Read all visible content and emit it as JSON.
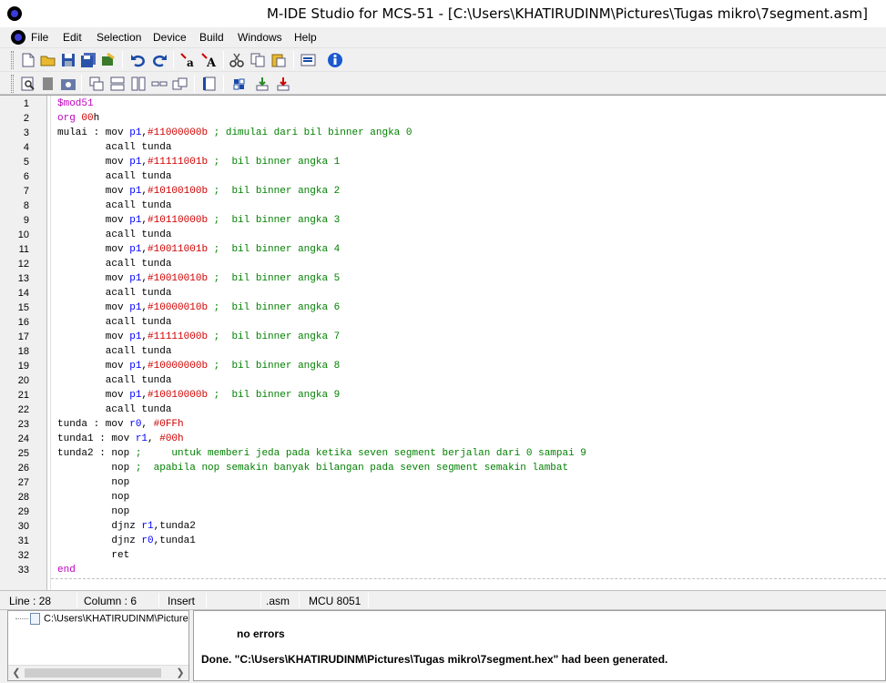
{
  "window": {
    "title": "M-IDE Studio for MCS-51 - [C:\\Users\\KHATIRUDINM\\Pictures\\Tugas mikro\\7segment.asm]"
  },
  "menu": {
    "items": [
      {
        "label": "File"
      },
      {
        "label": "Edit"
      },
      {
        "label": "Selection"
      },
      {
        "label": "Device"
      },
      {
        "label": "Build"
      },
      {
        "label": "Windows"
      },
      {
        "label": "Help"
      }
    ]
  },
  "toolbar": {
    "row1": [
      "new-file-icon",
      "open-folder-icon",
      "save-icon",
      "save-all-icon",
      "close-file-icon",
      "undo-icon",
      "redo-icon",
      "lowercase-icon",
      "uppercase-icon",
      "cut-icon",
      "copy-icon",
      "paste-icon",
      "properties-icon",
      "info-icon"
    ],
    "row2": [
      "find-icon",
      "bookmark-icon",
      "replace-icon",
      "cascade-windows-icon",
      "tile-horizontal-icon",
      "tile-vertical-icon",
      "minimize-all-icon",
      "arrange-icons-icon",
      "page-icon",
      "build-icon",
      "download-icon",
      "run-icon"
    ]
  },
  "editor": {
    "line_numbers": [
      "1",
      "2",
      "3",
      "4",
      "5",
      "6",
      "7",
      "8",
      "9",
      "10",
      "11",
      "12",
      "13",
      "14",
      "15",
      "16",
      "17",
      "18",
      "19",
      "20",
      "21",
      "22",
      "23",
      "24",
      "25",
      "26",
      "27",
      "28",
      "29",
      "30",
      "31",
      "32",
      "33"
    ],
    "code": [
      [
        {
          "t": "$mod51",
          "c": "kw"
        }
      ],
      [
        {
          "t": "org ",
          "c": "kw"
        },
        {
          "t": "00",
          "c": "num"
        },
        {
          "t": "h",
          "c": ""
        }
      ],
      [
        {
          "t": "mulai : mov ",
          "c": ""
        },
        {
          "t": "p1",
          "c": "reg"
        },
        {
          "t": ",",
          "c": ""
        },
        {
          "t": "#11000000b",
          "c": "num"
        },
        {
          "t": " ; dimulai dari bil binner angka 0",
          "c": "cmt"
        }
      ],
      [
        {
          "t": "        acall tunda",
          "c": ""
        }
      ],
      [
        {
          "t": "        mov ",
          "c": ""
        },
        {
          "t": "p1",
          "c": "reg"
        },
        {
          "t": ",",
          "c": ""
        },
        {
          "t": "#11111001b",
          "c": "num"
        },
        {
          "t": " ;  bil binner angka 1",
          "c": "cmt"
        }
      ],
      [
        {
          "t": "        acall tunda",
          "c": ""
        }
      ],
      [
        {
          "t": "        mov ",
          "c": ""
        },
        {
          "t": "p1",
          "c": "reg"
        },
        {
          "t": ",",
          "c": ""
        },
        {
          "t": "#10100100b",
          "c": "num"
        },
        {
          "t": " ;  bil binner angka 2",
          "c": "cmt"
        }
      ],
      [
        {
          "t": "        acall tunda",
          "c": ""
        }
      ],
      [
        {
          "t": "        mov ",
          "c": ""
        },
        {
          "t": "p1",
          "c": "reg"
        },
        {
          "t": ",",
          "c": ""
        },
        {
          "t": "#10110000b",
          "c": "num"
        },
        {
          "t": " ;  bil binner angka 3",
          "c": "cmt"
        }
      ],
      [
        {
          "t": "        acall tunda",
          "c": ""
        }
      ],
      [
        {
          "t": "        mov ",
          "c": ""
        },
        {
          "t": "p1",
          "c": "reg"
        },
        {
          "t": ",",
          "c": ""
        },
        {
          "t": "#10011001b",
          "c": "num"
        },
        {
          "t": " ;  bil binner angka 4",
          "c": "cmt"
        }
      ],
      [
        {
          "t": "        acall tunda",
          "c": ""
        }
      ],
      [
        {
          "t": "        mov ",
          "c": ""
        },
        {
          "t": "p1",
          "c": "reg"
        },
        {
          "t": ",",
          "c": ""
        },
        {
          "t": "#10010010b",
          "c": "num"
        },
        {
          "t": " ;  bil binner angka 5",
          "c": "cmt"
        }
      ],
      [
        {
          "t": "        acall tunda",
          "c": ""
        }
      ],
      [
        {
          "t": "        mov ",
          "c": ""
        },
        {
          "t": "p1",
          "c": "reg"
        },
        {
          "t": ",",
          "c": ""
        },
        {
          "t": "#10000010b",
          "c": "num"
        },
        {
          "t": " ;  bil binner angka 6",
          "c": "cmt"
        }
      ],
      [
        {
          "t": "        acall tunda",
          "c": ""
        }
      ],
      [
        {
          "t": "        mov ",
          "c": ""
        },
        {
          "t": "p1",
          "c": "reg"
        },
        {
          "t": ",",
          "c": ""
        },
        {
          "t": "#11111000b",
          "c": "num"
        },
        {
          "t": " ;  bil binner angka 7",
          "c": "cmt"
        }
      ],
      [
        {
          "t": "        acall tunda",
          "c": ""
        }
      ],
      [
        {
          "t": "        mov ",
          "c": ""
        },
        {
          "t": "p1",
          "c": "reg"
        },
        {
          "t": ",",
          "c": ""
        },
        {
          "t": "#10000000b",
          "c": "num"
        },
        {
          "t": " ;  bil binner angka 8",
          "c": "cmt"
        }
      ],
      [
        {
          "t": "        acall tunda",
          "c": ""
        }
      ],
      [
        {
          "t": "        mov ",
          "c": ""
        },
        {
          "t": "p1",
          "c": "reg"
        },
        {
          "t": ",",
          "c": ""
        },
        {
          "t": "#10010000b",
          "c": "num"
        },
        {
          "t": " ;  bil binner angka 9",
          "c": "cmt"
        }
      ],
      [
        {
          "t": "        acall tunda",
          "c": ""
        }
      ],
      [
        {
          "t": "tunda : mov ",
          "c": ""
        },
        {
          "t": "r0",
          "c": "reg"
        },
        {
          "t": ", ",
          "c": ""
        },
        {
          "t": "#0FFh",
          "c": "num"
        }
      ],
      [
        {
          "t": "tunda1 : mov ",
          "c": ""
        },
        {
          "t": "r1",
          "c": "reg"
        },
        {
          "t": ", ",
          "c": ""
        },
        {
          "t": "#00h",
          "c": "num"
        }
      ],
      [
        {
          "t": "tunda2 : nop ;     untuk memberi jeda pada ketika seven segment berjalan dari 0 sampai 9",
          "c": "cmt_after_nop"
        }
      ],
      [
        {
          "t": "         nop ;  apabila nop semakin banyak bilangan pada seven segment semakin lambat",
          "c": "cmt_after_nop"
        }
      ],
      [
        {
          "t": "         nop",
          "c": ""
        }
      ],
      [
        {
          "t": "         nop",
          "c": ""
        }
      ],
      [
        {
          "t": "         nop",
          "c": ""
        }
      ],
      [
        {
          "t": "         djnz ",
          "c": ""
        },
        {
          "t": "r1",
          "c": "reg"
        },
        {
          "t": ",tunda2",
          "c": ""
        }
      ],
      [
        {
          "t": "         djnz ",
          "c": ""
        },
        {
          "t": "r0",
          "c": "reg"
        },
        {
          "t": ",tunda1",
          "c": ""
        }
      ],
      [
        {
          "t": "         ret",
          "c": ""
        }
      ],
      [
        {
          "t": "end",
          "c": "kw"
        }
      ]
    ]
  },
  "status": {
    "line": "Line : 28",
    "column": "Column : 6",
    "mode": "Insert",
    "ext": ".asm",
    "mcu": "MCU  8051"
  },
  "project_panel": {
    "file_path": "C:\\Users\\KHATIRUDINM\\Pictures\\Tugas mikro"
  },
  "output": {
    "line1": "no errors",
    "line2": "Done. \"C:\\Users\\KHATIRUDINM\\Pictures\\Tugas mikro\\7segment.hex\" had been generated."
  },
  "colors": {
    "keyword": "#c000c0",
    "register": "#0000ff",
    "number": "#d00000",
    "comment": "#008000"
  }
}
